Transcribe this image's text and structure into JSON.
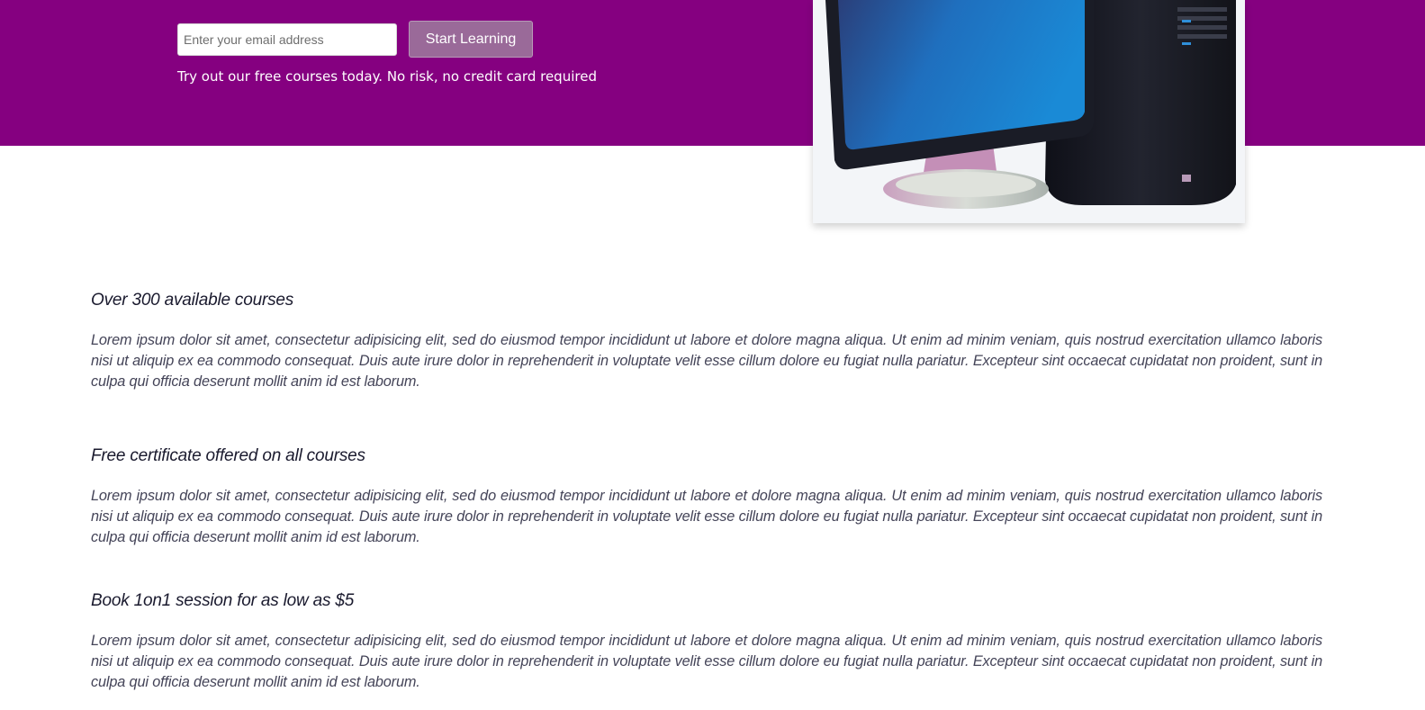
{
  "hero": {
    "email_placeholder": "Enter your email address",
    "email_value": "",
    "cta_label": "Start Learning",
    "tagline": "Try out our free courses today. No risk, no credit card required",
    "image_icon": "desktop-computer-illustration",
    "colors": {
      "background": "#850080",
      "button": "#9a6a99",
      "text": "#ffffff"
    }
  },
  "features": [
    {
      "title": "Over 300 available courses",
      "body": "Lorem ipsum dolor sit amet, consectetur adipisicing elit, sed do eiusmod tempor incididunt ut labore et dolore magna aliqua. Ut enim ad minim veniam, quis nostrud exercitation ullamco laboris nisi ut aliquip ex ea commodo consequat. Duis aute irure dolor in reprehenderit in voluptate velit esse cillum dolore eu fugiat nulla pariatur. Excepteur sint occaecat cupidatat non proident, sunt in culpa qui officia deserunt mollit anim id est laborum."
    },
    {
      "title": "Free certificate offered on all courses",
      "body": "Lorem ipsum dolor sit amet, consectetur adipisicing elit, sed do eiusmod tempor incididunt ut labore et dolore magna aliqua. Ut enim ad minim veniam, quis nostrud exercitation ullamco laboris nisi ut aliquip ex ea commodo consequat. Duis aute irure dolor in reprehenderit in voluptate velit esse cillum dolore eu fugiat nulla pariatur. Excepteur sint occaecat cupidatat non proident, sunt in culpa qui officia deserunt mollit anim id est laborum."
    },
    {
      "title": "Book 1on1 session for as low as $5",
      "body": "Lorem ipsum dolor sit amet, consectetur adipisicing elit, sed do eiusmod tempor incididunt ut labore et dolore magna aliqua. Ut enim ad minim veniam, quis nostrud exercitation ullamco laboris nisi ut aliquip ex ea commodo consequat. Duis aute irure dolor in reprehenderit in voluptate velit esse cillum dolore eu fugiat nulla pariatur. Excepteur sint occaecat cupidatat non proident, sunt in culpa qui officia deserunt mollit anim id est laborum."
    }
  ]
}
